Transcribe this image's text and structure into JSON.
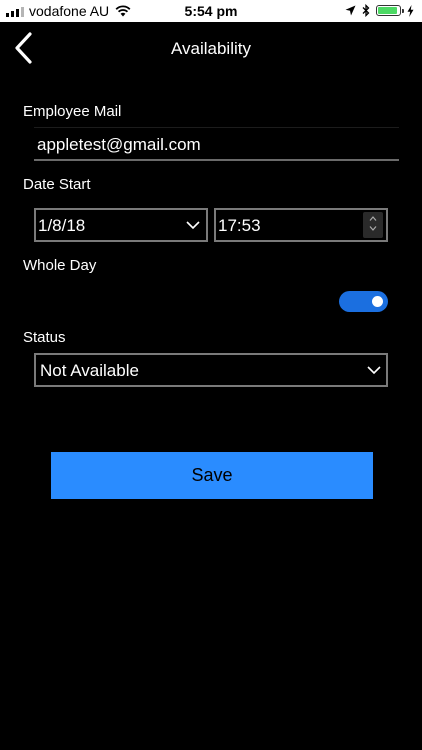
{
  "status_bar": {
    "carrier": "vodafone AU",
    "time": "5:54 pm",
    "battery_level": 0.9
  },
  "nav": {
    "title": "Availability",
    "back_icon": "chevron-left-icon"
  },
  "form": {
    "employee_mail_label": "Employee Mail",
    "employee_mail_value": "appletest@gmail.com",
    "date_start_label": "Date Start",
    "date_value": "1/8/18",
    "time_value": "17:53",
    "whole_day_label": "Whole Day",
    "whole_day_on": true,
    "status_label": "Status",
    "status_value": "Not Available"
  },
  "actions": {
    "save_label": "Save"
  },
  "colors": {
    "background": "#000000",
    "accent": "#2a8cff",
    "toggle_on": "#1b6fe0"
  }
}
